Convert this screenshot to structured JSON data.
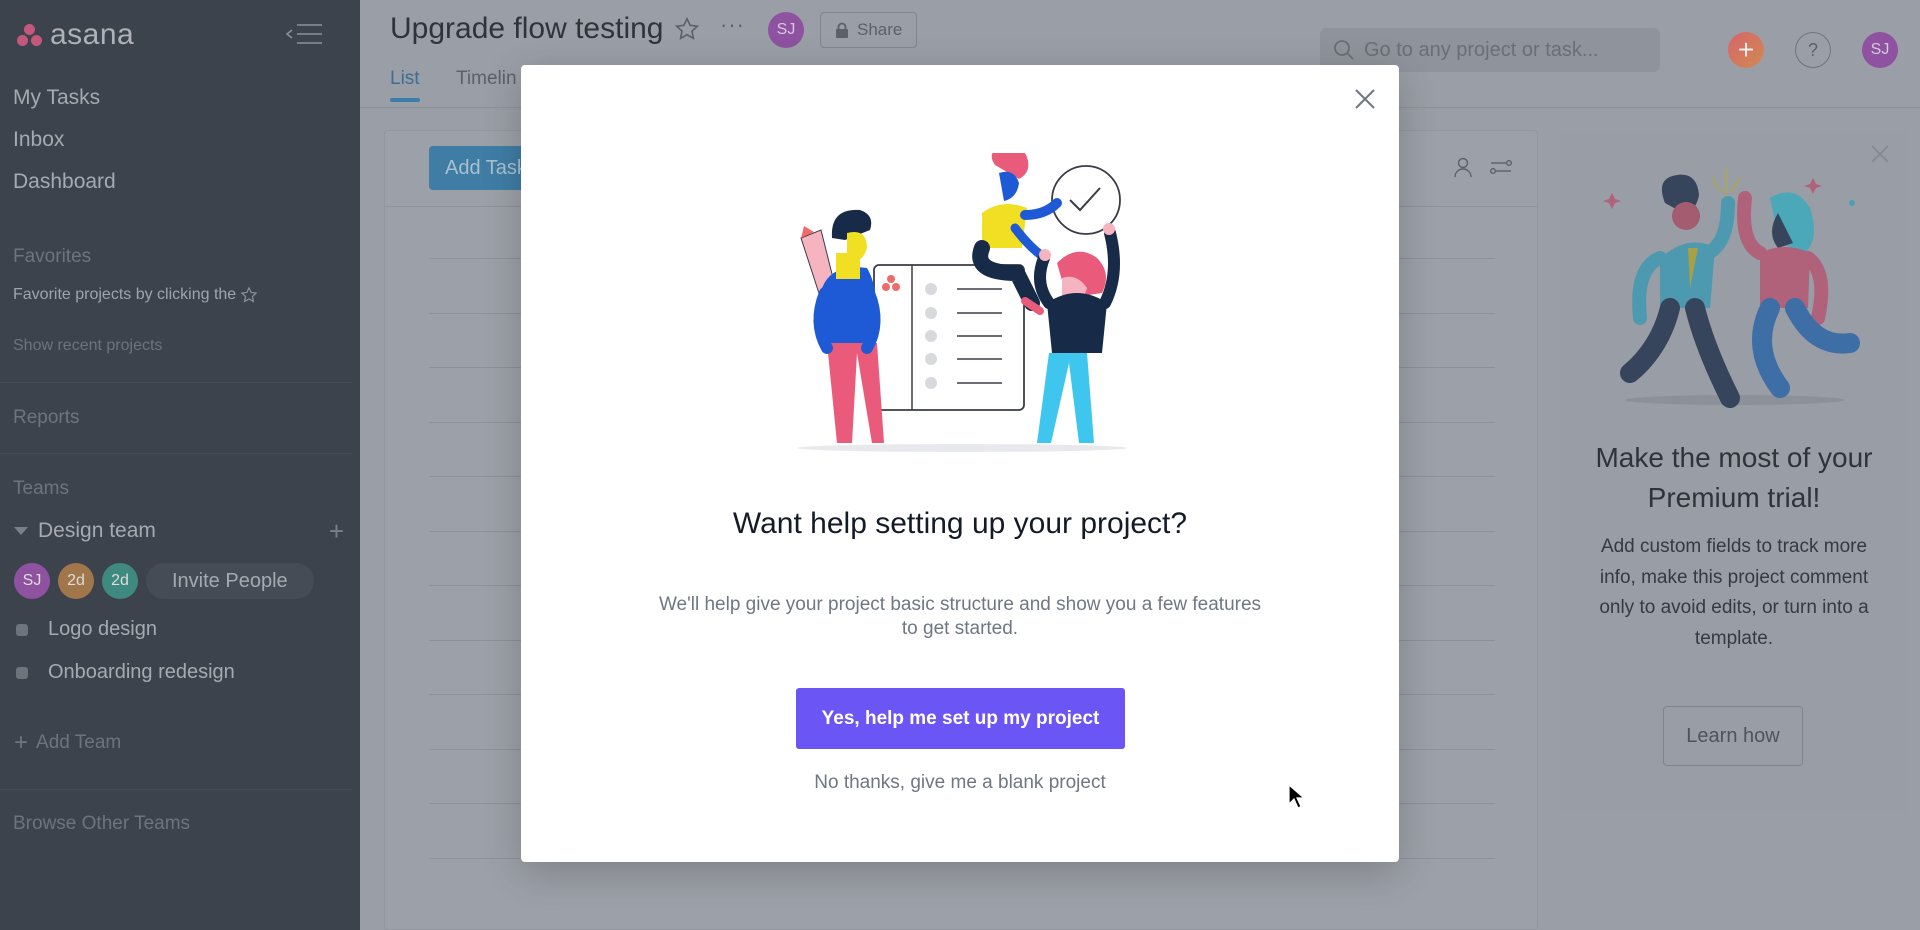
{
  "app": {
    "logo_text": "asana"
  },
  "sidebar": {
    "nav": [
      {
        "label": "My Tasks"
      },
      {
        "label": "Inbox"
      },
      {
        "label": "Dashboard"
      }
    ],
    "favorites_title": "Favorites",
    "favorites_hint": "Favorite projects by clicking the",
    "show_recent": "Show recent projects",
    "reports_title": "Reports",
    "teams_title": "Teams",
    "team": {
      "name": "Design team",
      "members": [
        {
          "initials": "SJ",
          "color": "#8e52a0"
        },
        {
          "initials": "2d",
          "color": "#a0764a"
        },
        {
          "initials": "2d",
          "color": "#3f8a80"
        }
      ],
      "invite_label": "Invite People",
      "projects": [
        {
          "name": "Logo design"
        },
        {
          "name": "Onboarding redesign"
        }
      ]
    },
    "add_team": "Add Team",
    "browse_teams": "Browse Other Teams"
  },
  "header": {
    "project_title": "Upgrade flow testing",
    "owner_initials": "SJ",
    "share_label": "Share",
    "tabs": [
      {
        "label": "List",
        "active": true
      },
      {
        "label": "Timelin",
        "active": false
      }
    ],
    "search_placeholder": "Go to any project or task...",
    "user_initials": "SJ",
    "help_label": "?"
  },
  "list": {
    "add_task_label": "Add Task"
  },
  "promo": {
    "title": "Make the most of your Premium trial!",
    "body": "Add custom fields to track more info, make this project comment only to avoid edits, or turn into a template.",
    "button_label": "Learn how"
  },
  "modal": {
    "title": "Want help setting up your project?",
    "description": "We'll help give your project basic structure and show you a few features to get started.",
    "primary_label": "Yes, help me set up my project",
    "secondary_label": "No thanks, give me a blank project",
    "primary_color": "#6c55f5"
  }
}
